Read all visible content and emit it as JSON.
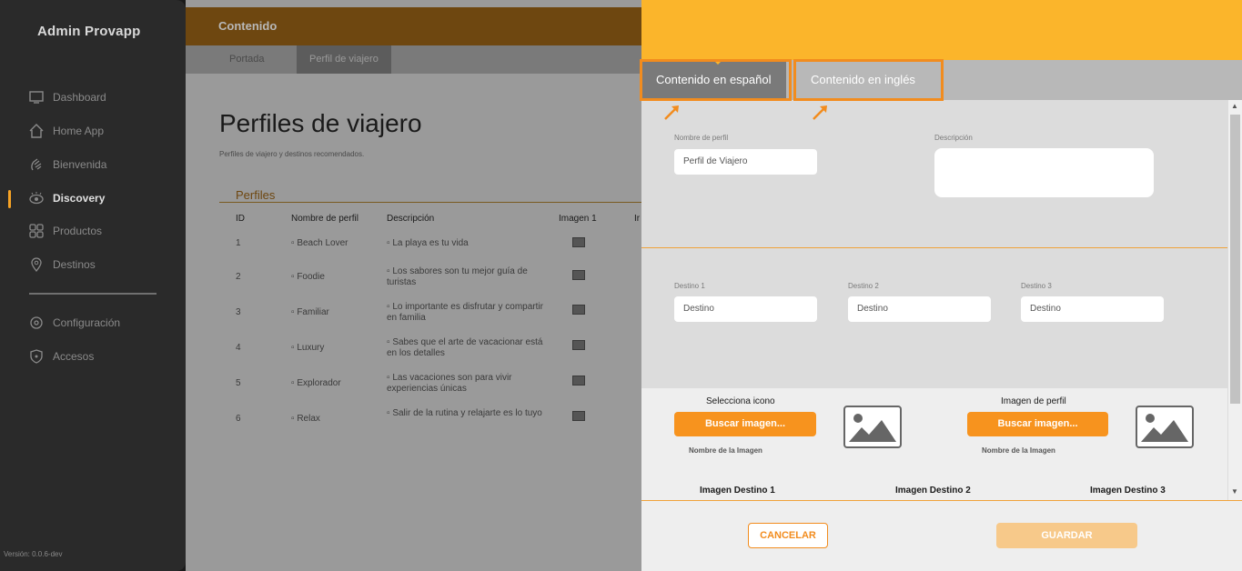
{
  "sidebar": {
    "title": "Admin Provapp",
    "items": [
      {
        "label": "Dashboard",
        "icon": "monitor-icon"
      },
      {
        "label": "Home App",
        "icon": "home-icon"
      },
      {
        "label": "Bienvenida",
        "icon": "wave-hand-icon"
      },
      {
        "label": "Discovery",
        "icon": "eye-icon",
        "active": true
      },
      {
        "label": "Productos",
        "icon": "grid-icon"
      },
      {
        "label": "Destinos",
        "icon": "map-pin-icon"
      }
    ],
    "items2": [
      {
        "label": "Configuración",
        "icon": "gear-icon"
      },
      {
        "label": "Accesos",
        "icon": "shield-icon"
      }
    ],
    "version": "Versión: 0.0.6-dev"
  },
  "main": {
    "header_title": "Contenido",
    "tabs": [
      {
        "label": "Portada"
      },
      {
        "label": "Perfil de viajero"
      }
    ],
    "page_title": "Perfiles de viajero",
    "page_subtitle": "Perfiles de viajero y destinos recomendados.",
    "section_title": "Perfiles",
    "columns": [
      "ID",
      "Nombre de perfil",
      "Descripción",
      "Imagen 1",
      "Ir"
    ],
    "rows": [
      {
        "id": "1",
        "name": "Beach Lover",
        "desc": "La playa es tu vida"
      },
      {
        "id": "2",
        "name": "Foodie",
        "desc": "Los sabores son tu mejor guía de turistas"
      },
      {
        "id": "3",
        "name": "Familiar",
        "desc": "Lo importante es disfrutar y compartir en familia"
      },
      {
        "id": "4",
        "name": "Luxury",
        "desc": "Sabes que el arte de vacacionar está en los detalles"
      },
      {
        "id": "5",
        "name": "Explorador",
        "desc": "Las vacaciones son para vivir experiencias únicas"
      },
      {
        "id": "6",
        "name": "Relax",
        "desc": "Salir de la rutina y relajarte es lo tuyo"
      }
    ]
  },
  "panel": {
    "tabs": [
      {
        "label": "Contenido en español"
      },
      {
        "label": "Contenido en inglés"
      }
    ],
    "profile_name_label": "Nombre de perfil",
    "profile_name_value": "Perfil de Viajero",
    "description_label": "Descripción",
    "destinations": [
      {
        "label": "Destino 1",
        "placeholder": "Destino"
      },
      {
        "label": "Destino 2",
        "placeholder": "Destino"
      },
      {
        "label": "Destino 3",
        "placeholder": "Destino"
      }
    ],
    "icon_section": {
      "title": "Selecciona icono",
      "button": "Buscar imagen...",
      "filename": "Nombre de la Imagen"
    },
    "profile_image_section": {
      "title": "Imagen de perfil",
      "button": "Buscar imagen...",
      "filename": "Nombre de la Imagen"
    },
    "dest_images": [
      "Imagen Destino 1",
      "Imagen Destino 2",
      "Imagen Destino 3"
    ],
    "cancel": "CANCELAR",
    "save": "GUARDAR"
  },
  "colors": {
    "accent": "#fbb52b",
    "orange": "#f7931e",
    "outline": "#f28c1e",
    "sidebar": "#2a2a2a"
  }
}
